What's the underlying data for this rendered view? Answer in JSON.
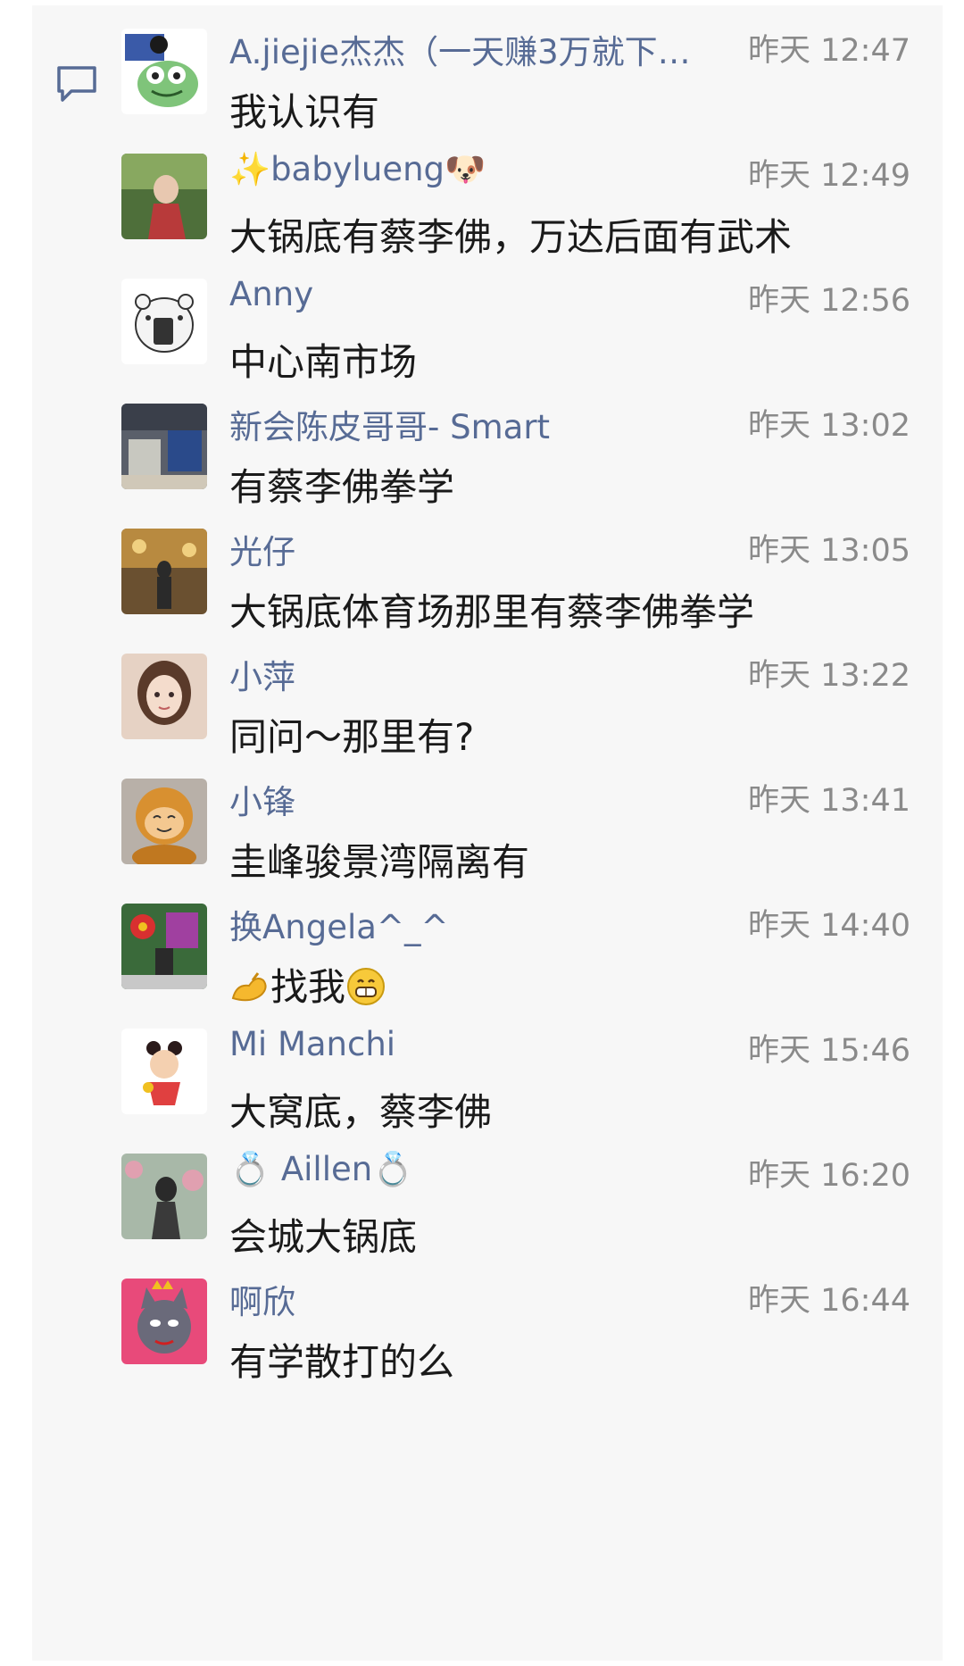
{
  "comments": [
    {
      "name": "A.jiejie杰杰（一天赚3万就下…",
      "time": "昨天 12:47",
      "text": "我认识有",
      "avatar_color": "#7fc47a"
    },
    {
      "name": "✨babylueng🐶",
      "time": "昨天 12:49",
      "text": "大锅底有蔡李佛，万达后面有武术",
      "avatar_color": "#6b8f4a"
    },
    {
      "name": "Anny",
      "time": "昨天 12:56",
      "text": "中心南市场",
      "avatar_color": "#f2f2f2"
    },
    {
      "name": "新会陈皮哥哥- Smart",
      "time": "昨天 13:02",
      "text": "有蔡李佛拳学",
      "avatar_color": "#5a5f6a"
    },
    {
      "name": "光仔",
      "time": "昨天 13:05",
      "text": "大锅底体育场那里有蔡李佛拳学",
      "avatar_color": "#8a6a3a"
    },
    {
      "name": "小萍",
      "time": "昨天 13:22",
      "text": "同问～那里有?",
      "avatar_color": "#d8b8a8"
    },
    {
      "name": "小锋",
      "time": "昨天 13:41",
      "text": "圭峰骏景湾隔离有",
      "avatar_color": "#e0a040"
    },
    {
      "name": "换Angela^_^",
      "time": "昨天 14:40",
      "text_before": "",
      "text": "找我",
      "avatar_color": "#3a6a3a",
      "emoji_before": "flexed-arm-icon",
      "emoji_after": "grinning-face-icon"
    },
    {
      "name": "Mi Manchi",
      "time": "昨天 15:46",
      "text": "大窝底，蔡李佛",
      "avatar_color": "#ffffff"
    },
    {
      "name": "💍 Aillen💍",
      "time": "昨天 16:20",
      "text": "会城大锅底",
      "avatar_color": "#9aa89a"
    },
    {
      "name": "啊欣",
      "time": "昨天 16:44",
      "text": "有学散打的么",
      "avatar_color": "#e84a7a"
    }
  ]
}
